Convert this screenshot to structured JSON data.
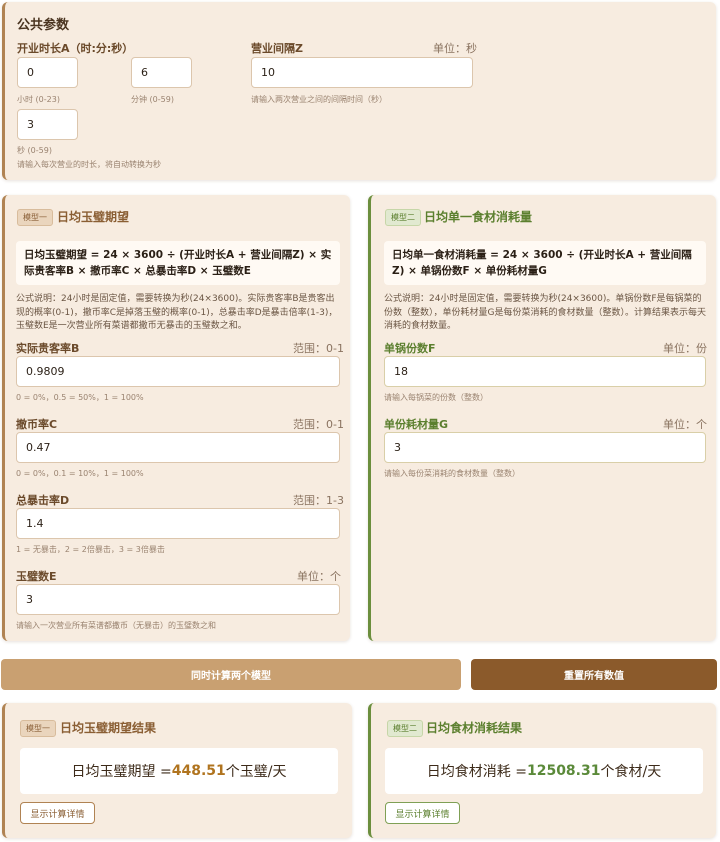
{
  "common": {
    "title": "公共参数",
    "open_duration_label": "开业时长A（时:分:秒）",
    "interval_label": "营业间隔Z",
    "interval_unit": "单位：秒",
    "hours_value": "0",
    "minutes_value": "6",
    "seconds_value": "3",
    "interval_value": "10",
    "hours_hint": "小时 (0-23)",
    "minutes_hint": "分钟 (0-59)",
    "seconds_hint": "秒 (0-59)",
    "interval_hint": "请输入两次营业之间的间隔时间（秒）",
    "duration_hint": "请输入每次营业的时长，将自动转换为秒"
  },
  "model1": {
    "badge": "模型一",
    "title": "日均玉璧期望",
    "formula": "日均玉璧期望 = 24 × 3600 ÷ (开业时长A + 营业间隔Z) × 实际贵客率B × 撤币率C × 总暴击率D × 玉璧数E",
    "description": "公式说明：24小时是固定值，需要转换为秒(24×3600)。实际贵客率B是贵客出现的概率(0-1)，撤币率C是掉落玉璧的概率(0-1)，总暴击率D是暴击倍率(1-3)，玉璧数E是一次营业所有菜谱都撒币无暴击的玉璧数之和。",
    "fields": [
      {
        "label": "实际贵客率B",
        "unit": "范围：0-1",
        "value": "0.9809",
        "hint": "0 = 0%，0.5 = 50%，1 = 100%"
      },
      {
        "label": "撤币率C",
        "unit": "范围：0-1",
        "value": "0.47",
        "hint": "0 = 0%，0.1 = 10%，1 = 100%"
      },
      {
        "label": "总暴击率D",
        "unit": "范围：1-3",
        "value": "1.4",
        "hint": "1 = 无暴击，2 = 2倍暴击，3 = 3倍暴击"
      },
      {
        "label": "玉璧数E",
        "unit": "单位：个",
        "value": "3",
        "hint": "请输入一次营业所有菜谱都撒币（无暴击）的玉璧数之和"
      }
    ]
  },
  "model2": {
    "badge": "模型二",
    "title": "日均单一食材消耗量",
    "formula": "日均单一食材消耗量 = 24 × 3600 ÷ (开业时长A + 营业间隔Z) × 单锅份数F × 单份耗材量G",
    "description": "公式说明：24小时是固定值，需要转换为秒(24×3600)。单锅份数F是每锅菜的份数（整数），单份耗材量G是每份菜消耗的食材数量（整数）。计算结果表示每天消耗的食材数量。",
    "fields": [
      {
        "label": "单锅份数F",
        "unit": "单位：份",
        "value": "18",
        "hint": "请输入每锅菜的份数（整数）"
      },
      {
        "label": "单份耗材量G",
        "unit": "单位：个",
        "value": "3",
        "hint": "请输入每份菜消耗的食材数量（整数）"
      }
    ]
  },
  "actions": {
    "calc_both": "同时计算两个模型",
    "reset_all": "重置所有数值"
  },
  "results": {
    "r1_badge": "模型一",
    "r1_title": "日均玉璧期望结果",
    "r1_prefix": "日均玉璧期望 =",
    "r1_value": "448.51",
    "r1_suffix": "个玉璧/天",
    "r2_badge": "模型二",
    "r2_title": "日均食材消耗结果",
    "r2_prefix": "日均食材消耗 =",
    "r2_value": "12508.31",
    "r2_suffix": "个食材/天",
    "detail_button": "显示计算详情"
  },
  "colors": {
    "brown_accent": "#b08353",
    "green_accent": "#6b8e3d",
    "calc_button": "#c9a071",
    "reset_button": "#8b5a2b"
  }
}
